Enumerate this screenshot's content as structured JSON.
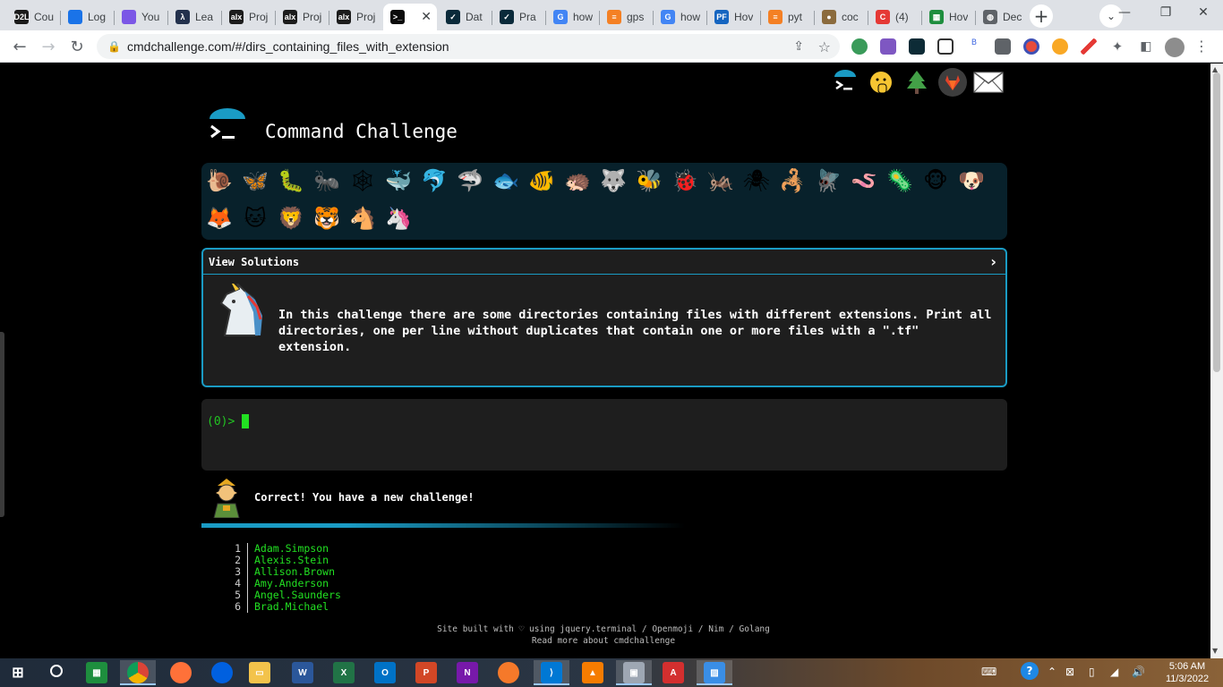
{
  "browser": {
    "tabs": [
      {
        "title": "Cou",
        "favicon": "d2l-icon",
        "fav_text": "D2L",
        "color": "#1a1a1a"
      },
      {
        "title": "Log",
        "favicon": "cloud-icon",
        "fav_text": "",
        "color": "#1a73e8"
      },
      {
        "title": "You",
        "favicon": "swirl-icon",
        "fav_text": "",
        "color": "#7b57e6"
      },
      {
        "title": "Lea",
        "favicon": "lambda-icon",
        "fav_text": "λ",
        "color": "#23314d"
      },
      {
        "title": "Proj",
        "favicon": "alx-icon",
        "fav_text": "alx",
        "color": "#1c1c1c"
      },
      {
        "title": "Proj",
        "favicon": "alx-icon",
        "fav_text": "alx",
        "color": "#1c1c1c"
      },
      {
        "title": "Proj",
        "favicon": "alx-icon",
        "fav_text": "alx",
        "color": "#1c1c1c"
      },
      {
        "title": "",
        "favicon": "terminal-icon",
        "fav_text": ">_",
        "color": "#0b0b0b"
      },
      {
        "title": "Dat",
        "favicon": "check-icon",
        "fav_text": "✓",
        "color": "#0a2a3a"
      },
      {
        "title": "Pra",
        "favicon": "check-icon",
        "fav_text": "✓",
        "color": "#0a2a3a"
      },
      {
        "title": "how",
        "favicon": "google-icon",
        "fav_text": "G",
        "color": "#4285f4"
      },
      {
        "title": "gps",
        "favicon": "stack-icon",
        "fav_text": "≡",
        "color": "#f48024"
      },
      {
        "title": "how",
        "favicon": "google-icon",
        "fav_text": "G",
        "color": "#4285f4"
      },
      {
        "title": "Hov",
        "favicon": "pf-icon",
        "fav_text": "PF",
        "color": "#1565c0"
      },
      {
        "title": "pyt",
        "favicon": "stack-icon",
        "fav_text": "≡",
        "color": "#f48024"
      },
      {
        "title": "coc",
        "favicon": "disc-icon",
        "fav_text": "●",
        "color": "#8b6b3d"
      },
      {
        "title": "(4)",
        "favicon": "c-icon",
        "fav_text": "C",
        "color": "#e53935"
      },
      {
        "title": "Hov",
        "favicon": "sheet-icon",
        "fav_text": "▦",
        "color": "#1e8e3e"
      },
      {
        "title": "Dec",
        "favicon": "globe-icon",
        "fav_text": "◍",
        "color": "#5f6368"
      }
    ],
    "url": "cmdchallenge.com/#/dirs_containing_files_with_extension"
  },
  "page": {
    "title": "Command Challenge",
    "emojis": [
      "🐌",
      "🦋",
      "🐛",
      "🐜",
      "🕸",
      "🐳",
      "🐬",
      "🦈",
      "🐟",
      "🐠",
      "🦔",
      "🐺",
      "🐝",
      "🐞",
      "🦗",
      "🕷",
      "🦂",
      "🪰",
      "🪱",
      "🦠",
      "🐵",
      "🐶",
      "🦊",
      "🐱",
      "🦁",
      "🐯",
      "🐴",
      "🦄"
    ],
    "view_solutions": "View Solutions",
    "challenge_text": "In this challenge there are some directories containing files with different extensions. Print all directories, one per line without duplicates that contain one or more files with a \".tf\" extension.",
    "prompt": "(0)>",
    "result_message": "Correct! You have a new challenge!",
    "output_lines": [
      {
        "num": "1",
        "text": "Adam.Simpson"
      },
      {
        "num": "2",
        "text": "Alexis.Stein"
      },
      {
        "num": "3",
        "text": "Allison.Brown"
      },
      {
        "num": "4",
        "text": "Amy.Anderson"
      },
      {
        "num": "5",
        "text": "Angel.Saunders"
      },
      {
        "num": "6",
        "text": "Brad.Michael"
      }
    ],
    "footer_line1": "Site built with ♡ using jquery.terminal / Openmoji / Nim / Golang",
    "footer_line2": "Read more about cmdchallenge"
  },
  "taskbar": {
    "time": "5:06 AM",
    "date": "11/3/2022"
  },
  "colors": {
    "accent": "#1a9bc4",
    "terminal_green": "#22e022",
    "panel_bg": "#1e1e1e",
    "emoji_bar_bg": "#08212b"
  }
}
